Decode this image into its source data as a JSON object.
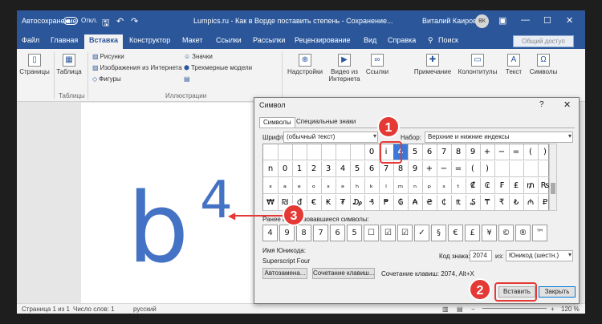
{
  "titlebar": {
    "autosave": "Автосохранение",
    "toggle": "Откл.",
    "title": "Lumpics.ru - Как в Ворде поставить степень - Сохранение...",
    "user": "Виталий Каиров",
    "initials": "ВК"
  },
  "menu": [
    "Файл",
    "Главная",
    "Вставка",
    "Конструктор",
    "Макет",
    "Ссылки",
    "Рассылки",
    "Рецензирование",
    "Вид",
    "Справка",
    "Поиск"
  ],
  "share": "Общий доступ",
  "ribbon": {
    "pages": "Страницы",
    "table": "Таблица",
    "tables_group": "Таблицы",
    "pictures": "Рисунки",
    "online_pictures": "Изображения из Интернета",
    "shapes": "Фигуры",
    "icons": "Значки",
    "models": "Трехмерные модели",
    "illustrations_group": "Иллюстрации",
    "addins": "Надстройки",
    "video_1": "Видео из",
    "video_2": "Интернета",
    "links": "Ссылки",
    "comment": "Примечание",
    "headers": "Колонтитулы",
    "text": "Текст",
    "symbols": "Символы"
  },
  "document": {
    "base": "b",
    "superscript": "4"
  },
  "dialog": {
    "title": "Символ",
    "help": "?",
    "close": "✕",
    "tab_symbols": "Символы",
    "tab_special": "Специальные знаки",
    "font_label": "Шрифт:",
    "font_value": "(обычный текст)",
    "subset_label": "Набор:",
    "subset_value": "Верхние и нижние индексы",
    "grid": [
      [
        "",
        "",
        "",
        "",
        "",
        "",
        "",
        "0",
        "i",
        "4",
        "5",
        "6",
        "7",
        "8",
        "9",
        "+",
        "−",
        "=",
        "(",
        ")"
      ],
      [
        "n",
        "0",
        "1",
        "2",
        "3",
        "4",
        "5",
        "6",
        "7",
        "8",
        "9",
        "+",
        "−",
        "=",
        "(",
        ")",
        "",
        "",
        "",
        ""
      ],
      [
        "ₓ",
        "ₐ",
        "ₑ",
        "ₒ",
        "ₓ",
        "ₔ",
        "ₕ",
        "ₖ",
        "ₗ",
        "ₘ",
        "ₙ",
        "ₚ",
        "ₛ",
        "ₜ",
        "₡",
        "₢",
        "₣",
        "₤",
        "₥",
        "₨"
      ],
      [
        "₩",
        "₪",
        "₫",
        "€",
        "₭",
        "₮",
        "₯",
        "₰",
        "₱",
        "₲",
        "₳",
        "₴",
        "₵",
        "₶",
        "₷",
        "₸",
        "₹",
        "₺",
        "₼",
        "₽"
      ]
    ],
    "selected": "4",
    "recent_label": "Ранее использовавшиеся символы:",
    "recent": [
      "4",
      "9",
      "8",
      "7",
      "6",
      "5",
      "☐",
      "☑",
      "☑",
      "✓",
      "§",
      "€",
      "£",
      "¥",
      "©",
      "®",
      "™"
    ],
    "unicode_name_label": "Имя Юникода:",
    "unicode_name": "Superscript Four",
    "code_label": "Код знака:",
    "code_value": "2074",
    "from_label": "из:",
    "from_value": "Юникод (шестн.)",
    "autocorrect": "Автозамена...",
    "shortcut_button": "Сочетание клавиш...",
    "shortcut_text": "Сочетание клавиш: 2074, Alt+X",
    "insert": "Вставить",
    "close_button": "Закрыть"
  },
  "status": {
    "page": "Страница 1 из 1",
    "words": "Число слов: 1",
    "lang": "русский",
    "zoom": "120 %"
  },
  "callouts": [
    "1",
    "2",
    "3"
  ]
}
